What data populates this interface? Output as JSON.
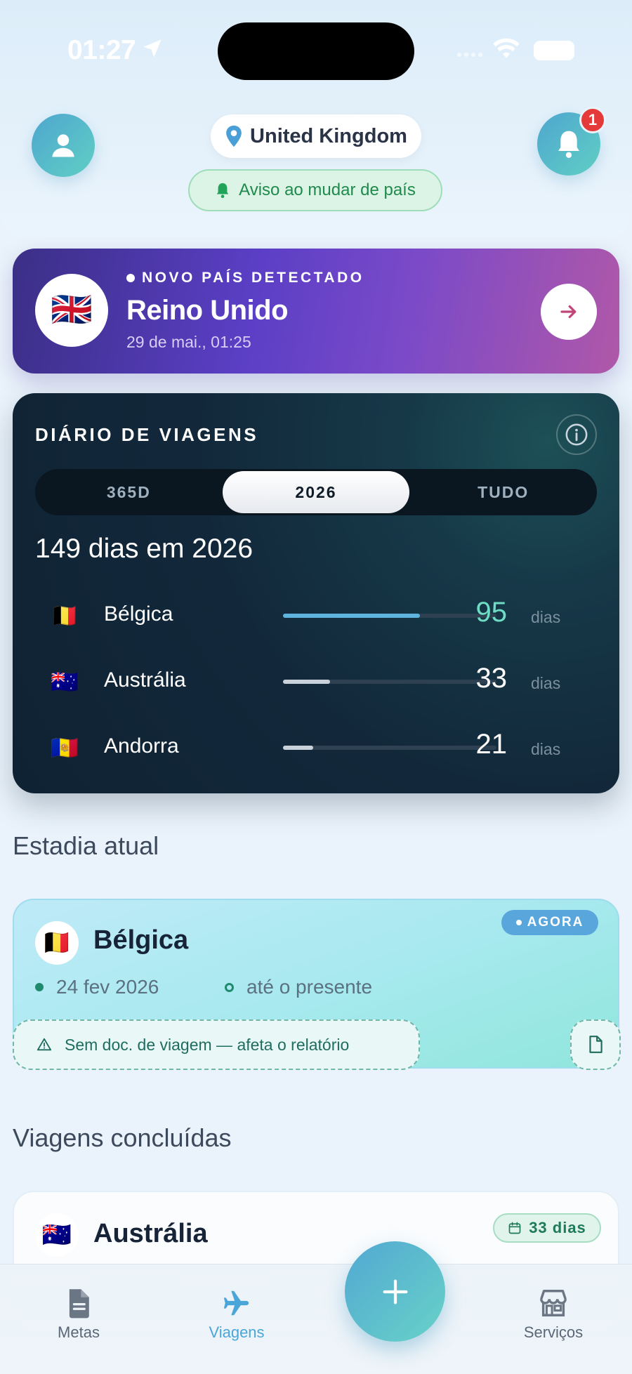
{
  "status_bar": {
    "time": "01:27"
  },
  "header": {
    "country_pill": "United Kingdom",
    "warning_pill": "Aviso ao mudar de país",
    "notification_count": "1"
  },
  "new_country": {
    "label": "NOVO PAÍS DETECTADO",
    "country": "Reino Unido",
    "timestamp": "29 de mai., 01:25",
    "flag": "🇬🇧"
  },
  "diary": {
    "title": "DIÁRIO DE VIAGENS",
    "tabs": [
      {
        "label": "365D"
      },
      {
        "label": "2026",
        "active": true
      },
      {
        "label": "TUDO"
      }
    ],
    "total": "149 dias em 2026",
    "rows": [
      {
        "flag": "🇧🇪",
        "country": "Bélgica",
        "days": "95",
        "unit": "dias",
        "fraction": 0.64,
        "color": "#5fb4dd",
        "num_color": "#6fdcc4"
      },
      {
        "flag": "🇦🇺",
        "country": "Austrália",
        "days": "33",
        "unit": "dias",
        "fraction": 0.22,
        "color": "#c9d2da",
        "num_color": "#ffffff"
      },
      {
        "flag": "🇦🇩",
        "country": "Andorra",
        "days": "21",
        "unit": "dias",
        "fraction": 0.14,
        "color": "#c9d2da",
        "num_color": "#ffffff"
      }
    ]
  },
  "current_stay": {
    "heading": "Estadia atual",
    "flag": "🇧🇪",
    "country": "Bélgica",
    "badge": "AGORA",
    "start": "24 fev 2026",
    "end": "até o presente",
    "doc_warning": "Sem doc. de viagem — afeta o relatório"
  },
  "completed": {
    "heading": "Viagens concluídas",
    "flag": "🇦🇺",
    "country": "Austrália",
    "days_badge": "33 dias"
  },
  "tabbar": {
    "tabs": [
      {
        "label": "Metas",
        "icon": "document-icon"
      },
      {
        "label": "Viagens",
        "icon": "airplane-icon",
        "active": true
      },
      {
        "label": "Serviços",
        "icon": "store-icon"
      }
    ]
  },
  "colors": {
    "accent": "#4aa6d8",
    "teal": "#5fcfc4",
    "diary_bg": "#12283a",
    "banner_purple": "#5b3fc6"
  }
}
